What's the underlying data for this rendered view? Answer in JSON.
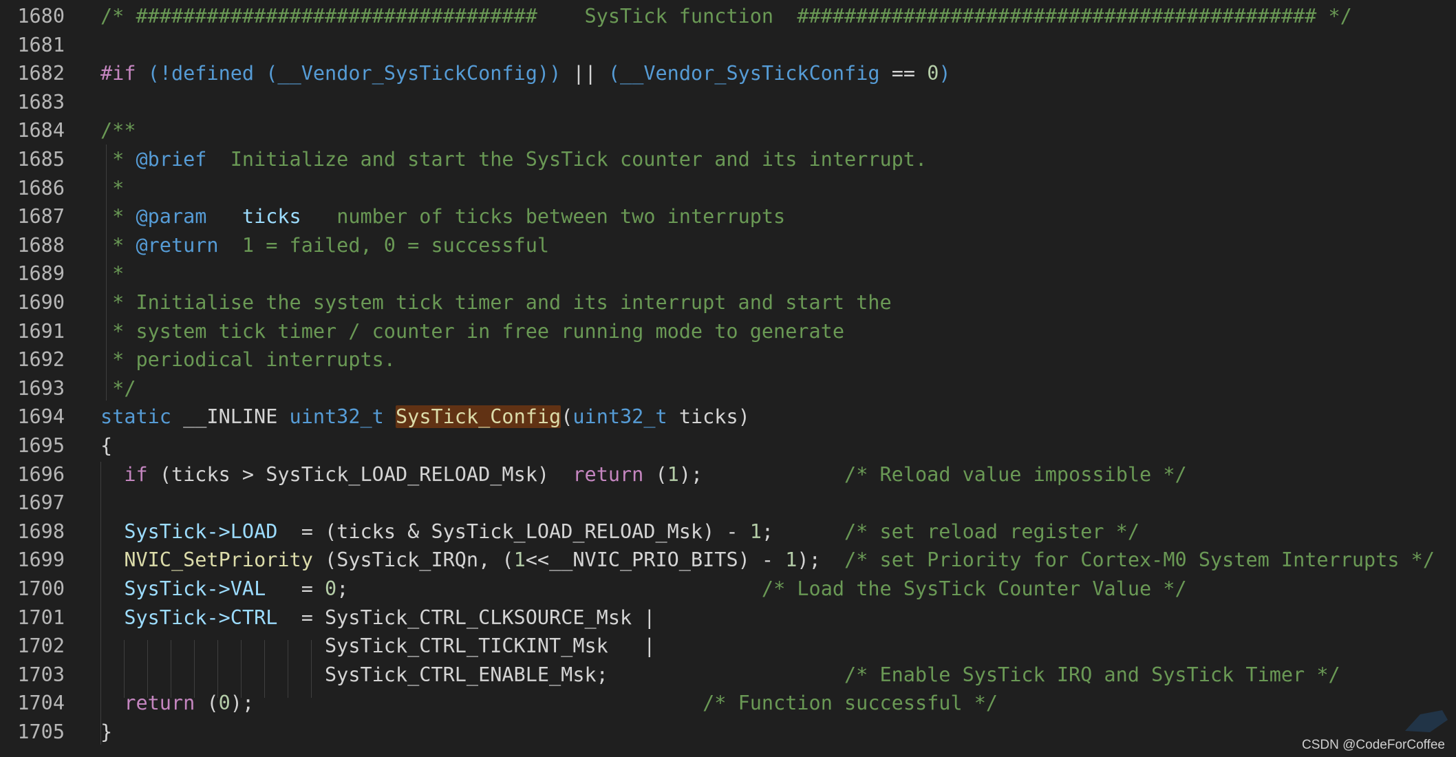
{
  "editor": {
    "colors": {
      "background": "#1f1f1f",
      "comment": "#6a9955",
      "keyword": "#569cd6",
      "preprocessor": "#c586c0",
      "function": "#dcdcaa",
      "variable": "#9cdcfe",
      "number": "#b5cea8",
      "highlight": "#613214"
    },
    "lines": [
      {
        "number": "1680",
        "tokens": [
          {
            "c": "cm",
            "t": "/* ##################################    SysTick function  ############################################ */"
          }
        ]
      },
      {
        "number": "1681",
        "tokens": []
      },
      {
        "number": "1682",
        "tokens": [
          {
            "c": "pp",
            "t": "#if"
          },
          {
            "c": "id",
            "t": " "
          },
          {
            "c": "kw",
            "t": "(!defined ("
          },
          {
            "c": "kw",
            "t": "__Vendor_SysTickConfig"
          },
          {
            "c": "kw",
            "t": "))"
          },
          {
            "c": "id",
            "t": " || "
          },
          {
            "c": "kw",
            "t": "("
          },
          {
            "c": "kw",
            "t": "__Vendor_SysTickConfig"
          },
          {
            "c": "id",
            "t": " == "
          },
          {
            "c": "num",
            "t": "0"
          },
          {
            "c": "kw",
            "t": ")"
          }
        ]
      },
      {
        "number": "1683",
        "tokens": []
      },
      {
        "number": "1684",
        "tokens": [
          {
            "c": "cm",
            "t": "/**"
          }
        ]
      },
      {
        "number": "1685",
        "tokens": [
          {
            "c": "cm",
            "t": " * "
          },
          {
            "c": "tag",
            "t": "@brief"
          },
          {
            "c": "cm",
            "t": "  Initialize and start the SysTick counter and its interrupt."
          }
        ]
      },
      {
        "number": "1686",
        "tokens": [
          {
            "c": "cm",
            "t": " *"
          }
        ]
      },
      {
        "number": "1687",
        "tokens": [
          {
            "c": "cm",
            "t": " * "
          },
          {
            "c": "tag",
            "t": "@param"
          },
          {
            "c": "cm",
            "t": "   "
          },
          {
            "c": "var",
            "t": "ticks"
          },
          {
            "c": "cm",
            "t": "   number of ticks between two interrupts"
          }
        ]
      },
      {
        "number": "1688",
        "tokens": [
          {
            "c": "cm",
            "t": " * "
          },
          {
            "c": "tag",
            "t": "@return"
          },
          {
            "c": "cm",
            "t": "  1 = failed, 0 = successful"
          }
        ]
      },
      {
        "number": "1689",
        "tokens": [
          {
            "c": "cm",
            "t": " *"
          }
        ]
      },
      {
        "number": "1690",
        "tokens": [
          {
            "c": "cm",
            "t": " * Initialise the system tick timer and its interrupt and start the"
          }
        ]
      },
      {
        "number": "1691",
        "tokens": [
          {
            "c": "cm",
            "t": " * system tick timer / counter in free running mode to generate"
          }
        ]
      },
      {
        "number": "1692",
        "tokens": [
          {
            "c": "cm",
            "t": " * periodical interrupts."
          }
        ]
      },
      {
        "number": "1693",
        "tokens": [
          {
            "c": "cm",
            "t": " */"
          }
        ]
      },
      {
        "number": "1694",
        "tokens": [
          {
            "c": "kw",
            "t": "static"
          },
          {
            "c": "id",
            "t": " __INLINE "
          },
          {
            "c": "kw",
            "t": "uint32_t"
          },
          {
            "c": "id",
            "t": " "
          },
          {
            "c": "hl",
            "t": "SysTick_Config"
          },
          {
            "c": "id",
            "t": "("
          },
          {
            "c": "kw",
            "t": "uint32_t"
          },
          {
            "c": "id",
            "t": " ticks)"
          }
        ]
      },
      {
        "number": "1695",
        "tokens": [
          {
            "c": "id",
            "t": "{"
          }
        ]
      },
      {
        "number": "1696",
        "tokens": [
          {
            "c": "id",
            "t": "  "
          },
          {
            "c": "pp",
            "t": "if"
          },
          {
            "c": "id",
            "t": " (ticks > SysTick_LOAD_RELOAD_Msk)  "
          },
          {
            "c": "pp",
            "t": "return"
          },
          {
            "c": "id",
            "t": " ("
          },
          {
            "c": "num",
            "t": "1"
          },
          {
            "c": "id",
            "t": ");            "
          },
          {
            "c": "cm",
            "t": "/* Reload value impossible */"
          }
        ]
      },
      {
        "number": "1697",
        "tokens": []
      },
      {
        "number": "1698",
        "tokens": [
          {
            "c": "id",
            "t": "  "
          },
          {
            "c": "var",
            "t": "SysTick->LOAD"
          },
          {
            "c": "id",
            "t": "  = (ticks & SysTick_LOAD_RELOAD_Msk) - "
          },
          {
            "c": "num",
            "t": "1"
          },
          {
            "c": "id",
            "t": ";      "
          },
          {
            "c": "cm",
            "t": "/* set reload register */"
          }
        ]
      },
      {
        "number": "1699",
        "tokens": [
          {
            "c": "id",
            "t": "  "
          },
          {
            "c": "fn",
            "t": "NVIC_SetPriority"
          },
          {
            "c": "id",
            "t": " (SysTick_IRQn, ("
          },
          {
            "c": "num",
            "t": "1"
          },
          {
            "c": "id",
            "t": "<<__NVIC_PRIO_BITS) - "
          },
          {
            "c": "num",
            "t": "1"
          },
          {
            "c": "id",
            "t": ");  "
          },
          {
            "c": "cm",
            "t": "/* set Priority for Cortex-M0 System Interrupts */"
          }
        ]
      },
      {
        "number": "1700",
        "tokens": [
          {
            "c": "id",
            "t": "  "
          },
          {
            "c": "var",
            "t": "SysTick->VAL"
          },
          {
            "c": "id",
            "t": "   = "
          },
          {
            "c": "num",
            "t": "0"
          },
          {
            "c": "id",
            "t": ";                                   "
          },
          {
            "c": "cm",
            "t": "/* Load the SysTick Counter Value */"
          }
        ]
      },
      {
        "number": "1701",
        "tokens": [
          {
            "c": "id",
            "t": "  "
          },
          {
            "c": "var",
            "t": "SysTick->CTRL"
          },
          {
            "c": "id",
            "t": "  = SysTick_CTRL_CLKSOURCE_Msk |"
          }
        ]
      },
      {
        "number": "1702",
        "tokens": [
          {
            "c": "id",
            "t": "                   SysTick_CTRL_TICKINT_Msk   |"
          }
        ]
      },
      {
        "number": "1703",
        "tokens": [
          {
            "c": "id",
            "t": "                   SysTick_CTRL_ENABLE_Msk;                    "
          },
          {
            "c": "cm",
            "t": "/* Enable SysTick IRQ and SysTick Timer */"
          }
        ]
      },
      {
        "number": "1704",
        "tokens": [
          {
            "c": "id",
            "t": "  "
          },
          {
            "c": "pp",
            "t": "return"
          },
          {
            "c": "id",
            "t": " ("
          },
          {
            "c": "num",
            "t": "0"
          },
          {
            "c": "id",
            "t": ");                                      "
          },
          {
            "c": "cm",
            "t": "/* Function successful */"
          }
        ]
      },
      {
        "number": "1705",
        "tokens": [
          {
            "c": "id",
            "t": "}"
          }
        ]
      }
    ]
  },
  "watermark": "CSDN @CodeForCoffee"
}
